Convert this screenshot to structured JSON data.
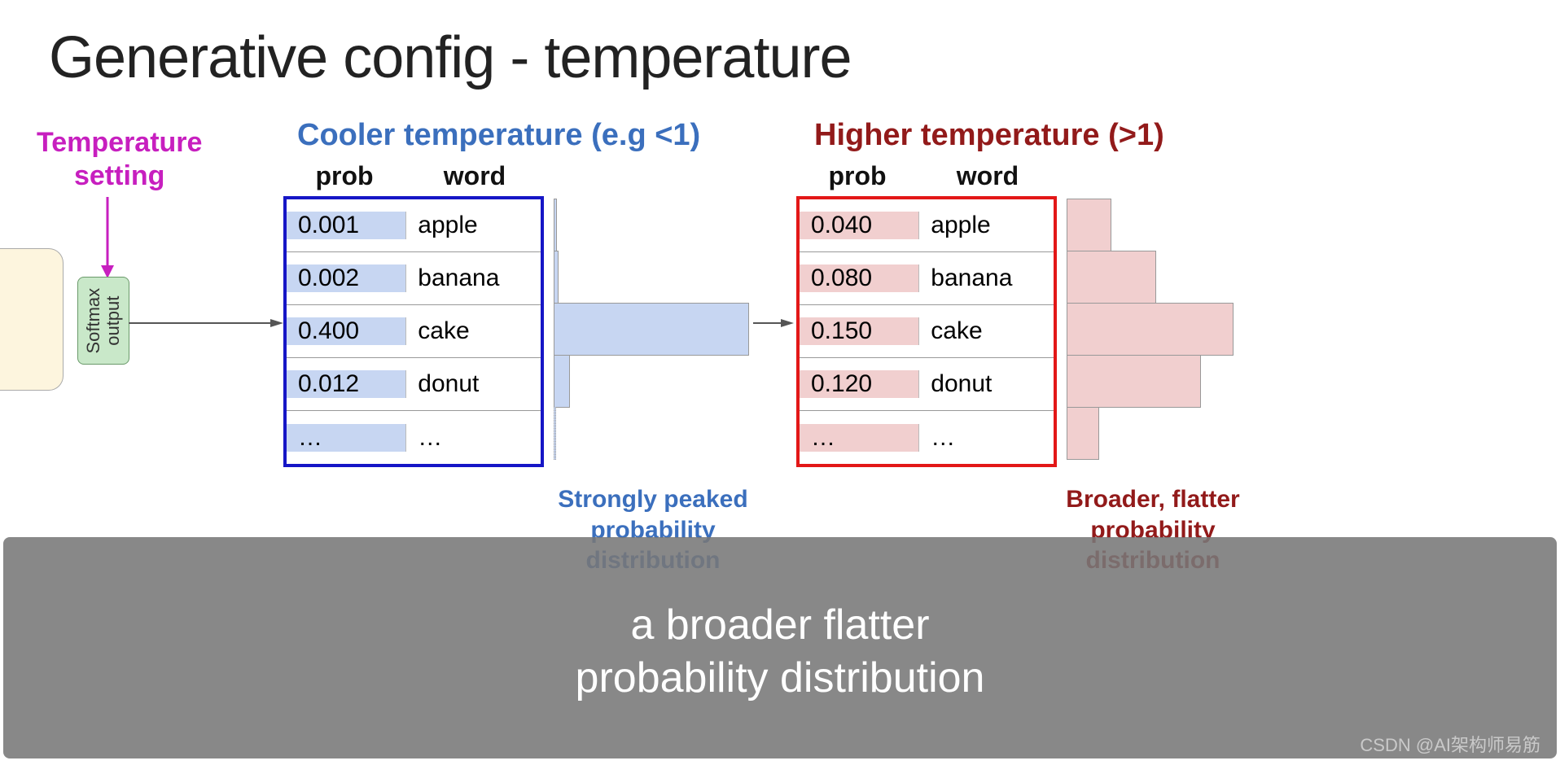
{
  "title": "Generative config - temperature",
  "temperature_label_line1": "Temperature",
  "temperature_label_line2": "setting",
  "softmax_label": "Softmax\noutput",
  "cooler": {
    "title": "Cooler temperature (e.g <1)",
    "headers": {
      "prob": "prob",
      "word": "word"
    },
    "rows": [
      {
        "prob": "0.001",
        "word": "apple"
      },
      {
        "prob": "0.002",
        "word": "banana"
      },
      {
        "prob": "0.400",
        "word": "cake"
      },
      {
        "prob": "0.012",
        "word": "donut"
      },
      {
        "prob": "…",
        "word": "…"
      }
    ],
    "caption_line1": "Strongly peaked",
    "caption_line2": "probability",
    "caption_line3": "distribution"
  },
  "higher": {
    "title": "Higher temperature (>1)",
    "headers": {
      "prob": "prob",
      "word": "word"
    },
    "rows": [
      {
        "prob": "0.040",
        "word": "apple"
      },
      {
        "prob": "0.080",
        "word": "banana"
      },
      {
        "prob": "0.150",
        "word": "cake"
      },
      {
        "prob": "0.120",
        "word": "donut"
      },
      {
        "prob": "…",
        "word": "…"
      }
    ],
    "caption_line1": "Broader, flatter",
    "caption_line2": "probability",
    "caption_line3": "distribution"
  },
  "subtitle_line1": "a broader flatter",
  "subtitle_line2": "probability distribution",
  "watermark": "CSDN @AI架构师易筋",
  "chart_data": [
    {
      "type": "bar",
      "title": "Cooler temperature (e.g <1)",
      "categories": [
        "apple",
        "banana",
        "cake",
        "donut",
        "…"
      ],
      "values": [
        0.001,
        0.002,
        0.4,
        0.012,
        null
      ],
      "xlabel": "prob",
      "ylabel": "word",
      "orientation": "horizontal",
      "note": "Strongly peaked probability distribution"
    },
    {
      "type": "bar",
      "title": "Higher temperature (>1)",
      "categories": [
        "apple",
        "banana",
        "cake",
        "donut",
        "…"
      ],
      "values": [
        0.04,
        0.08,
        0.15,
        0.12,
        null
      ],
      "xlabel": "prob",
      "ylabel": "word",
      "orientation": "horizontal",
      "note": "Broader, flatter probability distribution"
    }
  ],
  "colors": {
    "accent_blue": "#3b6fbd",
    "accent_red": "#921a1a",
    "table_blue_border": "#1616c6",
    "table_red_border": "#e31717",
    "fill_blue": "#c7d6f2",
    "fill_red": "#f1cfcf",
    "magenta": "#c71fbf"
  }
}
